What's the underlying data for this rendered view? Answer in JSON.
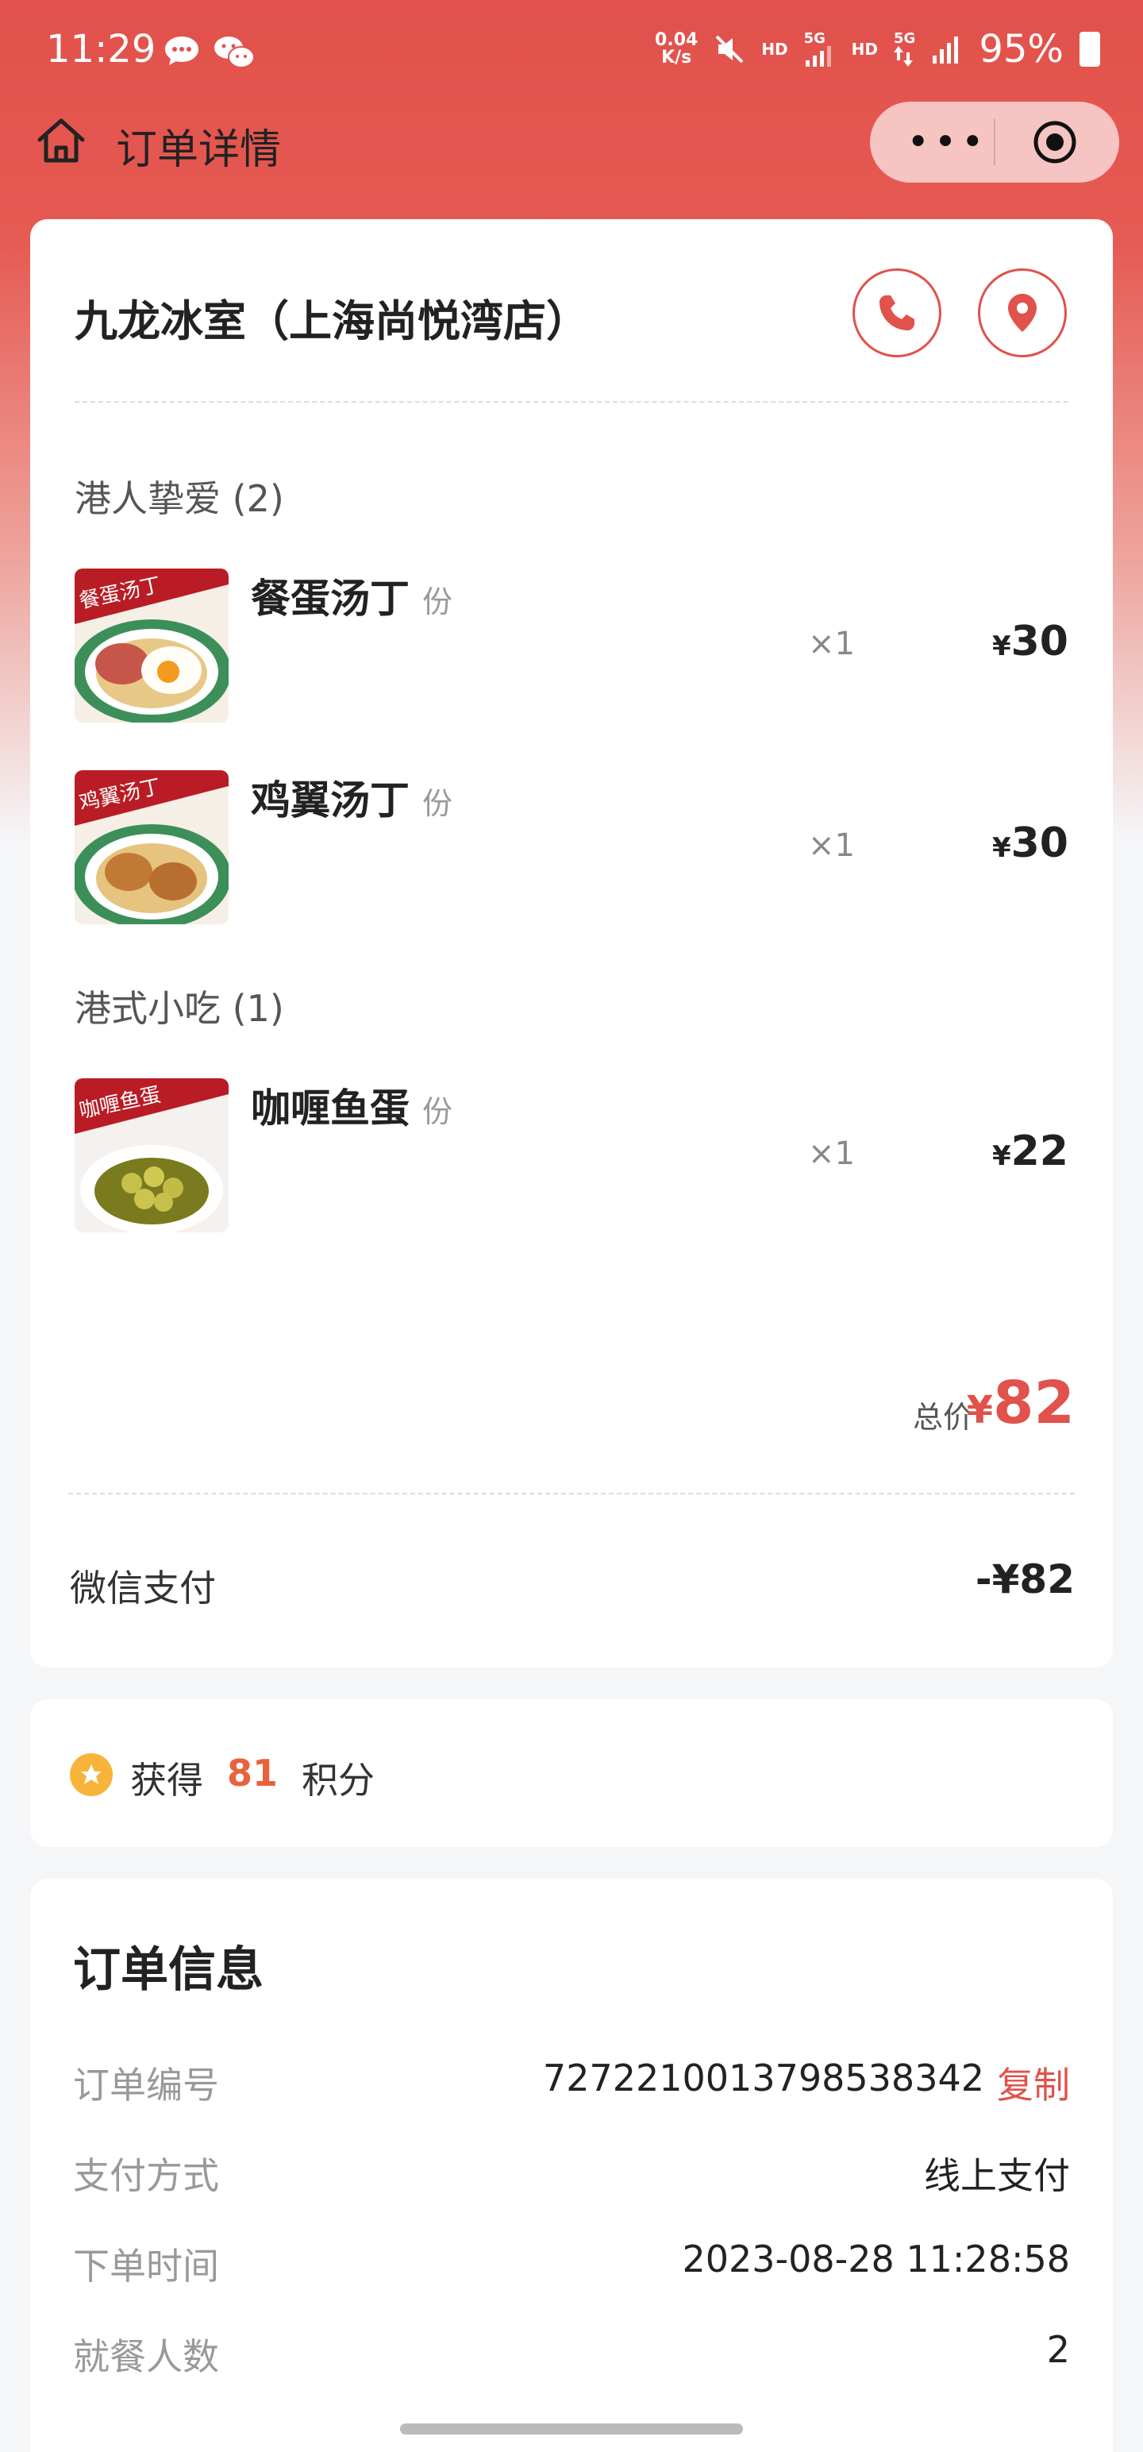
{
  "status_bar": {
    "time": "11:29",
    "speed_value": "0.04",
    "speed_unit": "K/s",
    "network_1": "HD",
    "network_1_gen": "5G",
    "network_2": "HD",
    "network_2_gen": "5G",
    "battery": "95%"
  },
  "header": {
    "title": "订单详情",
    "more_label": "•••"
  },
  "store": {
    "name": "九龙冰室（上海尚悦湾店）"
  },
  "categories": [
    {
      "label": "港人挚爱 (2)",
      "items": [
        {
          "name": "餐蛋汤丁",
          "unit": "份",
          "qty": "×1",
          "price": "30",
          "image_caption": "餐蛋汤丁"
        },
        {
          "name": "鸡翼汤丁",
          "unit": "份",
          "qty": "×1",
          "price": "30",
          "image_caption": "鸡翼汤丁"
        }
      ]
    },
    {
      "label": "港式小吃 (1)",
      "items": [
        {
          "name": "咖喱鱼蛋",
          "unit": "份",
          "qty": "×1",
          "price": "22",
          "image_caption": "咖喱鱼蛋"
        }
      ]
    }
  ],
  "currency": "¥",
  "total": {
    "label": "总价",
    "value": "82"
  },
  "payment": {
    "label": "微信支付",
    "value": "-¥82"
  },
  "points": {
    "prefix": "获得",
    "value": "81",
    "suffix": "积分"
  },
  "order_info": {
    "title": "订单信息",
    "rows": [
      {
        "label": "订单编号",
        "value": "7272210013798538342",
        "action": "复制"
      },
      {
        "label": "支付方式",
        "value": "线上支付"
      },
      {
        "label": "下单时间",
        "value": "2023-08-28 11:28:58"
      },
      {
        "label": "就餐人数",
        "value": "2"
      }
    ]
  },
  "colors": {
    "brand_red": "#e0524b",
    "points_orange": "#e8633c",
    "star_yellow": "#f8b43a"
  }
}
